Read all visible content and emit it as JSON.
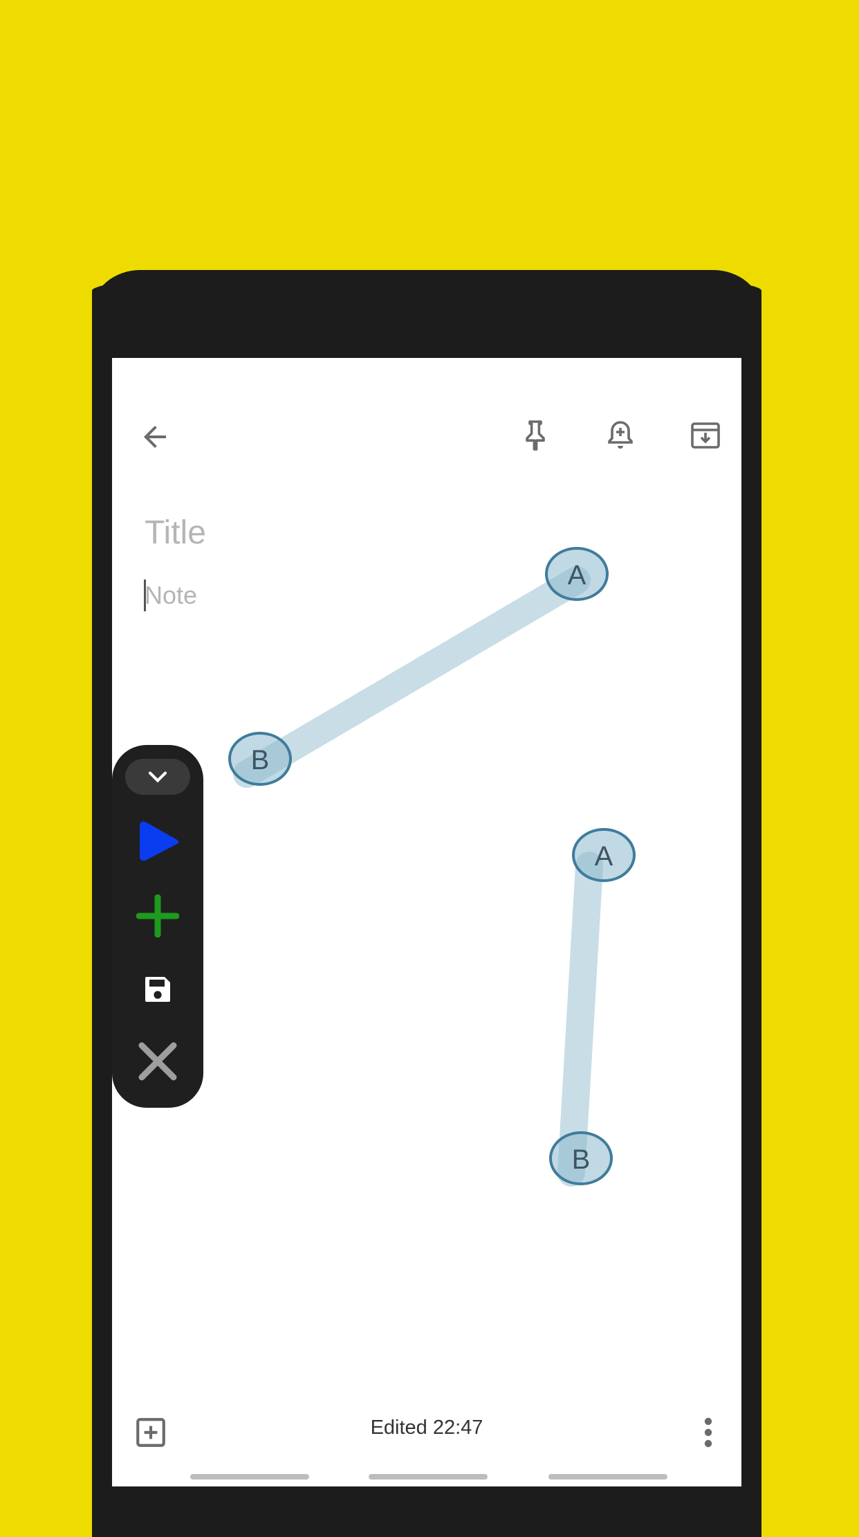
{
  "note": {
    "title_placeholder": "Title",
    "body_placeholder": "Note",
    "edited_label": "Edited 22:47"
  },
  "toolbar_icons": {
    "back": "arrow-left-icon",
    "pin": "pin-icon",
    "reminder": "bell-plus-icon",
    "archive": "archive-icon",
    "add_box": "add-box-icon",
    "more": "more-vertical-icon"
  },
  "gestures": [
    {
      "start_label": "A",
      "end_label": "B"
    },
    {
      "start_label": "A",
      "end_label": "B"
    }
  ],
  "automation_panel": {
    "icons": [
      "chevron-down-icon",
      "play-icon",
      "plus-icon",
      "save-icon",
      "close-icon"
    ],
    "colors": {
      "play": "#0A3CF0",
      "plus": "#1E9A1E",
      "save": "#FFFFFF",
      "close": "#9E9E9E"
    }
  },
  "colors": {
    "background": "#EEDC00",
    "device": "#1C1C1C",
    "gesture_stroke": "#C8DDE5",
    "gesture_circle": "#3F7C9B"
  }
}
